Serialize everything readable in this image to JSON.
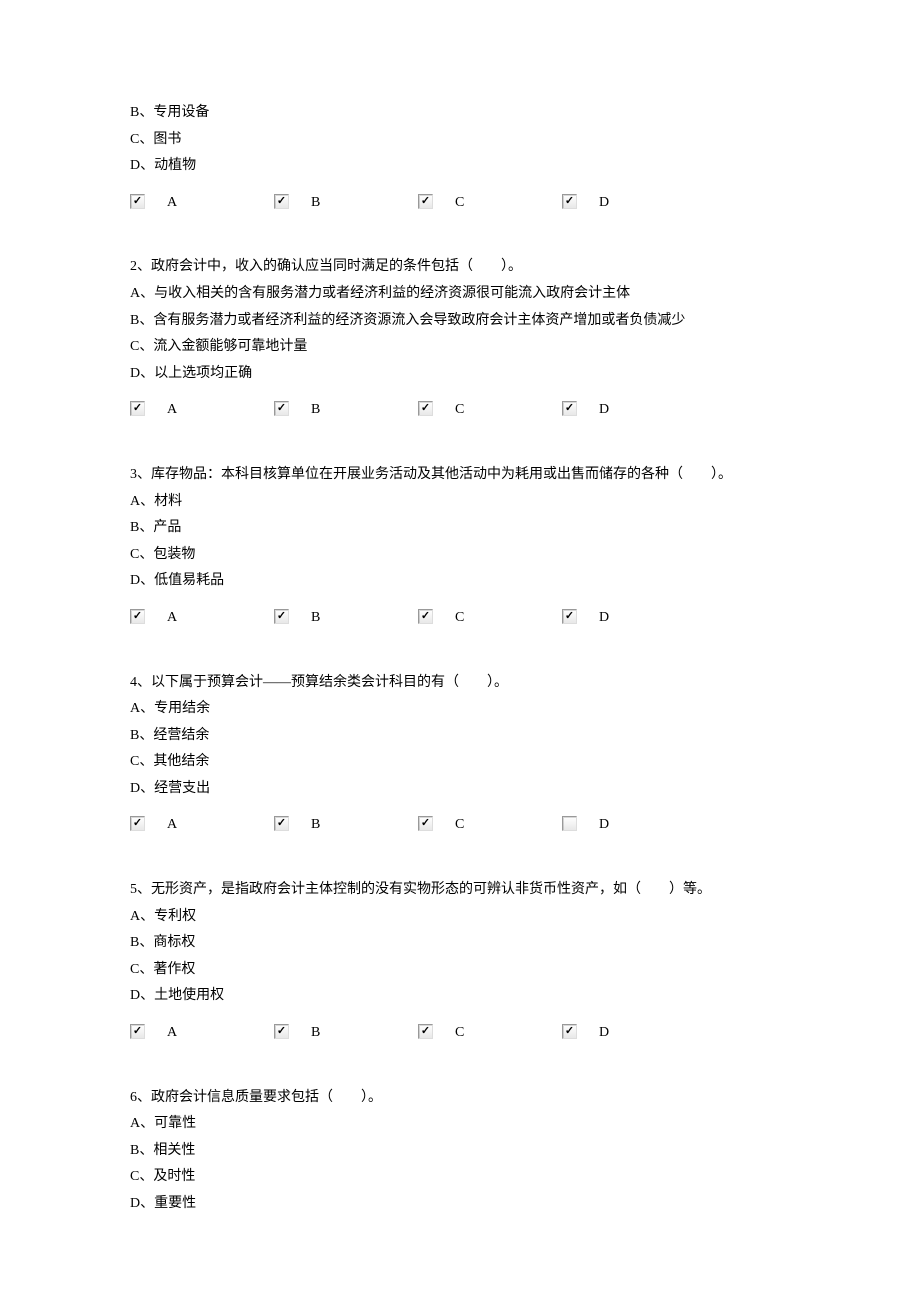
{
  "cbLabels": [
    "A",
    "B",
    "C",
    "D"
  ],
  "questions": [
    {
      "prestem": [
        "B、专用设备",
        "C、图书",
        "D、动植物"
      ],
      "checked": [
        true,
        true,
        true,
        true
      ]
    },
    {
      "stem": "2、政府会计中，收入的确认应当同时满足的条件包括（　　）。",
      "options": [
        "A、与收入相关的含有服务潜力或者经济利益的经济资源很可能流入政府会计主体",
        "B、含有服务潜力或者经济利益的经济资源流入会导致政府会计主体资产增加或者负债减少",
        "C、流入金额能够可靠地计量",
        "D、以上选项均正确"
      ],
      "checked": [
        true,
        true,
        true,
        true
      ]
    },
    {
      "stem": "3、库存物品：本科目核算单位在开展业务活动及其他活动中为耗用或出售而储存的各种（　　）。",
      "options": [
        "A、材料",
        "B、产品",
        "C、包装物",
        "D、低值易耗品"
      ],
      "checked": [
        true,
        true,
        true,
        true
      ]
    },
    {
      "stem": "4、以下属于预算会计——预算结余类会计科目的有（　　）。",
      "options": [
        "A、专用结余",
        "B、经营结余",
        "C、其他结余",
        "D、经营支出"
      ],
      "checked": [
        true,
        true,
        true,
        false
      ]
    },
    {
      "stem": "5、无形资产，是指政府会计主体控制的没有实物形态的可辨认非货币性资产，如（　　）等。",
      "options": [
        "A、专利权",
        "B、商标权",
        "C、著作权",
        "D、土地使用权"
      ],
      "checked": [
        true,
        true,
        true,
        true
      ]
    },
    {
      "stem": "6、政府会计信息质量要求包括（　　）。",
      "options": [
        "A、可靠性",
        "B、相关性",
        "C、及时性",
        "D、重要性"
      ],
      "noCheckboxes": true
    }
  ]
}
